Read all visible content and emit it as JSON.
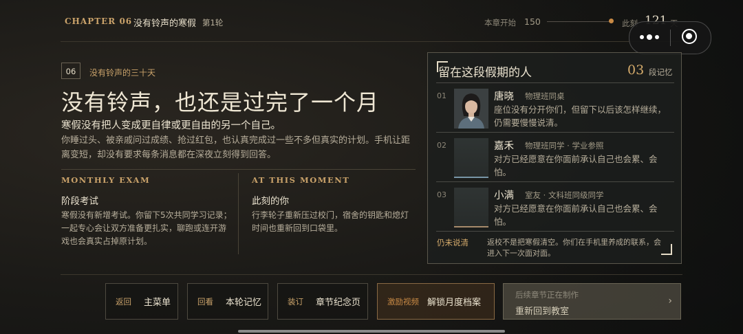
{
  "header": {
    "chapter": "CHAPTER 06",
    "chapter_title": "没有铃声的寒假",
    "round": "第1轮",
    "progress_label": "本章开始",
    "progress_start": "150",
    "now_label": "此刻",
    "now_value": "121",
    "now_unit": "天"
  },
  "episode": {
    "number": "06",
    "title": "没有铃声的三十天",
    "headline": "没有铃声，也还是过完了一个月",
    "subtitle": "寒假没有把人变成更自律或更自由的另一个自己。",
    "body": "你睡过头、被亲戚问过成绩、抢过红包，也认真完成过一些不多但真实的计划。手机让距离变短，却没有要求每条消息都在深夜立刻得到回答。"
  },
  "sections": [
    {
      "heading": "MONTHLY EXAM",
      "title": "阶段考试",
      "body": "寒假没有新增考试。你留下5次共同学习记录；一起专心会让双方准备更扎实，聊跑或连开游戏也会真实占掉原计划。"
    },
    {
      "heading": "AT THIS MOMENT",
      "title": "此刻的你",
      "body": "行李轮子重新压过校门，宿舍的钥匙和熄灯时间也重新回到口袋里。"
    }
  ],
  "panel": {
    "title": "留在这段假期的人",
    "count": "03",
    "count_unit": "段记忆",
    "people": [
      {
        "index": "01",
        "name": "唐晓",
        "role": "物理班同桌",
        "desc": "座位没有分开你们，但留下以后该怎样继续，仍需要慢慢说清。"
      },
      {
        "index": "02",
        "name": "嘉禾",
        "role": "物理班同学 · 学业参照",
        "desc": "对方已经愿意在你面前承认自己也会累、会怕。"
      },
      {
        "index": "03",
        "name": "小满",
        "role": "室友 · 文科班同级同学",
        "desc": "对方已经愿意在你面前承认自己也会累、会怕。"
      }
    ],
    "footer_tag": "仍未说清",
    "footer_text": "返校不是把寒假清空。你们在手机里养成的联系，会进入下一次面对面。"
  },
  "buttons": [
    {
      "key": "返回",
      "label": "主菜单"
    },
    {
      "key": "回看",
      "label": "本轮记忆"
    },
    {
      "key": "装订",
      "label": "章节纪念页"
    },
    {
      "key": "激励视频",
      "label": "解锁月度档案"
    }
  ],
  "next_button": {
    "status": "后续章节正在制作",
    "label": "重新回到教室",
    "arrow": "›"
  },
  "colors": {
    "accent": "#c9a26a",
    "progress_dot": "#c98a45",
    "background": "#1b1a17"
  },
  "progress_fraction": 0.95
}
